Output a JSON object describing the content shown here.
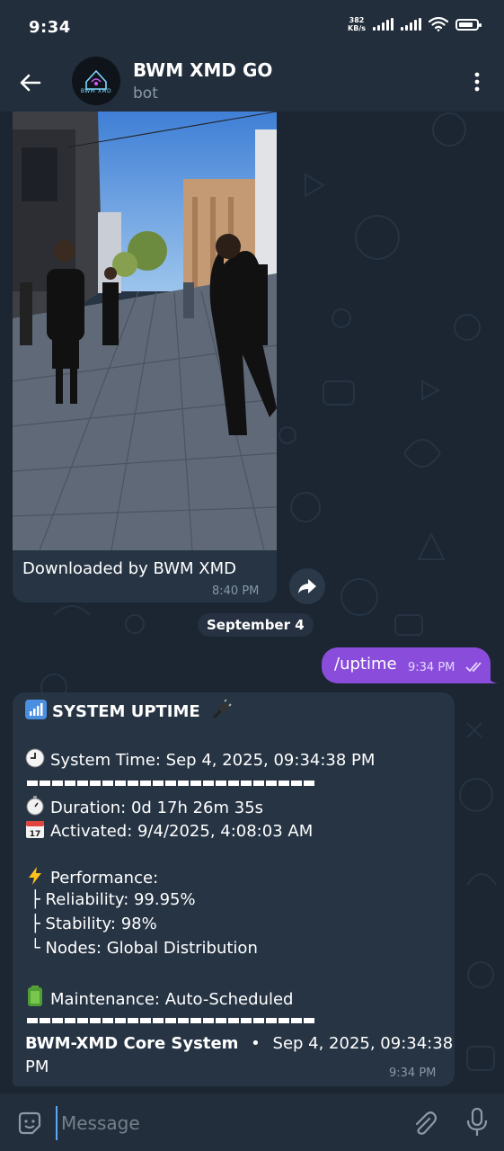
{
  "status_bar": {
    "time": "9:34",
    "net_speed_value": "382",
    "net_speed_unit": "KB/s",
    "battery_percent": 85
  },
  "header": {
    "title": "BWM XMD GO",
    "subtitle": "bot",
    "avatar_text": "BWM XMD"
  },
  "messages": {
    "media": {
      "caption": "Downloaded by BWM XMD",
      "time": "8:40 PM"
    },
    "date_separator": "September 4",
    "outgoing": {
      "text": "/uptime",
      "time": "9:34 PM"
    },
    "incoming": {
      "title": "SYSTEM UPTIME",
      "system_time": "System Time: Sep 4, 2025, 09:34:38 PM",
      "duration": "Duration: 0d 17h 26m 35s",
      "activated": "Activated: 9/4/2025, 4:08:03 AM",
      "performance": "Performance:",
      "reliability": "├ Reliability: 99.95%",
      "stability": "├ Stability: 98%",
      "nodes": "└ Nodes: Global Distribution",
      "maintenance": "Maintenance: Auto-Scheduled",
      "footer_name": "BWM-XMD Core System",
      "footer_bullet": "•",
      "footer_time_a": "Sep 4, 2025, 09:34:38",
      "footer_time_b": "PM",
      "time": "9:34 PM"
    }
  },
  "input": {
    "placeholder": "Message"
  },
  "colors": {
    "outgoing_bubble": "#8a4ddb",
    "incoming_bubble": "#263444",
    "header": "#222e3b",
    "accent": "#5ea7f5"
  },
  "icons": [
    "back-arrow-icon",
    "more-vertical-icon",
    "forward-icon",
    "double-check-icon",
    "signal-bars-icon",
    "plug-icon",
    "clock-icon",
    "stopwatch-icon",
    "calendar-icon",
    "lightning-icon",
    "battery-icon",
    "sticker-icon",
    "paperclip-icon",
    "microphone-icon",
    "wifi-icon"
  ]
}
